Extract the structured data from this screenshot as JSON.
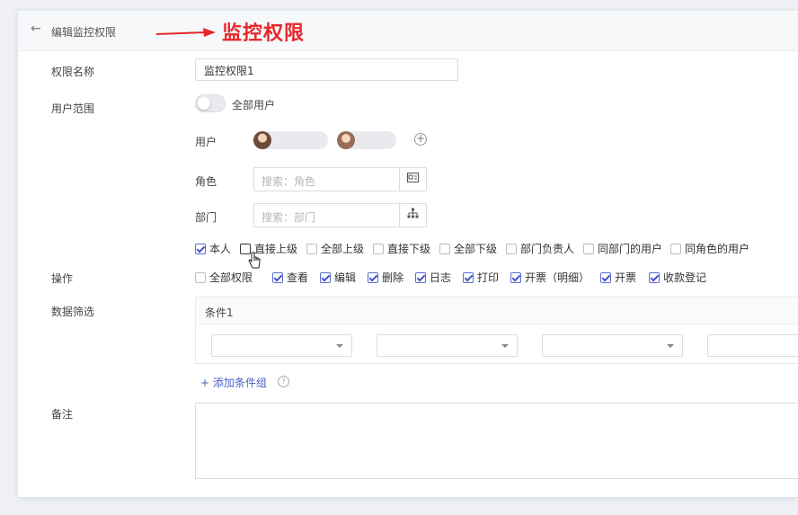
{
  "header": {
    "back_icon": "arrow-left-icon",
    "breadcrumb": "编辑监控权限",
    "annotation_title": "监控权限",
    "annotation_color": "#e8272a"
  },
  "form": {
    "name_label": "权限名称",
    "name_value": "监控权限1",
    "scope_label": "用户范围",
    "scope_toggle_label": "全部用户",
    "scope_toggle_on": false,
    "users_label": "用户",
    "roles_label": "角色",
    "roles_placeholder": "搜索：角色",
    "depts_label": "部门",
    "depts_placeholder": "搜索：部门",
    "relations": [
      {
        "label": "本人",
        "checked": true
      },
      {
        "label": "直接上级",
        "checked": false
      },
      {
        "label": "全部上级",
        "checked": false
      },
      {
        "label": "直接下级",
        "checked": false
      },
      {
        "label": "全部下级",
        "checked": false
      },
      {
        "label": "部门负责人",
        "checked": false
      },
      {
        "label": "同部门的用户",
        "checked": false
      },
      {
        "label": "同角色的用户",
        "checked": false
      }
    ],
    "ops_label": "操作",
    "operations": [
      {
        "label": "全部权限",
        "checked": false
      },
      {
        "label": "查看",
        "checked": true
      },
      {
        "label": "编辑",
        "checked": true
      },
      {
        "label": "删除",
        "checked": true
      },
      {
        "label": "日志",
        "checked": true
      },
      {
        "label": "打印",
        "checked": true
      },
      {
        "label": "开票（明细）",
        "checked": true
      },
      {
        "label": "开票",
        "checked": true
      },
      {
        "label": "收款登记",
        "checked": true
      }
    ],
    "filter_label": "数据筛选",
    "condition_title": "条件1",
    "add_condition": "+  添加条件组",
    "remark_label": "备注"
  }
}
